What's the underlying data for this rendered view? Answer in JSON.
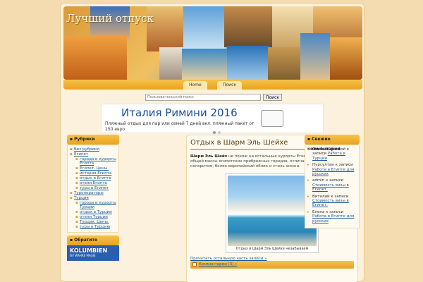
{
  "site": {
    "title": "Лучший отпуск"
  },
  "nav": {
    "tabs": [
      {
        "label": "Home"
      },
      {
        "label": "Поиск"
      }
    ]
  },
  "search": {
    "placeholder": "Пользовательский поиск",
    "button": "Поиск"
  },
  "ad": {
    "headline": "Италия Римини 2016",
    "subtext": "Пляжный отдых для пар или семей 7 дней вкл. пляжный пакет от 150 евро"
  },
  "left_sidebar": {
    "rubrics_title": "Рубрики",
    "categories": [
      {
        "label": "Без рубрики",
        "level": 0
      },
      {
        "label": "Египет",
        "level": 0
      },
      {
        "label": "города и курорты Египта",
        "level": 1
      },
      {
        "label": "Египет. Цены.",
        "level": 1
      },
      {
        "label": "история Египта",
        "level": 1
      },
      {
        "label": "отдых в Египте",
        "level": 1
      },
      {
        "label": "отели Египта",
        "level": 1
      },
      {
        "label": "туры в Египет",
        "level": 1
      },
      {
        "label": "Туроператоры",
        "level": 0
      },
      {
        "label": "Турция",
        "level": 0
      },
      {
        "label": "города и курорты Турции",
        "level": 1
      },
      {
        "label": "отдых в Турции",
        "level": 1
      },
      {
        "label": "отели Турции",
        "level": 1
      },
      {
        "label": "Турция. Цены.",
        "level": 1
      },
      {
        "label": "туры в Турцию",
        "level": 1
      }
    ],
    "attention_title": "Обратите внимание!",
    "banner": {
      "name": "KOLUMBIEN",
      "tagline": "IST WAHRE MAGIE"
    }
  },
  "right_sidebar": {
    "title": "Свежие комментарии",
    "comments": [
      {
        "author": "Отабаев Анобой",
        "text": "к записи",
        "link": "Работа в Турции"
      },
      {
        "author": "Нурсултан",
        "text": "к записи",
        "link": "Работа в Египте для русских"
      },
      {
        "author": "admin",
        "text": "к записи",
        "link": "Стоимость визы в Египет."
      },
      {
        "author": "Виталий",
        "text": "к записи",
        "link": "Стоимость визы в Египет."
      },
      {
        "author": "Елена",
        "text": "к записи",
        "link": "Работа в Египте для русских"
      }
    ]
  },
  "post": {
    "title": "Отдых в Шарм Эль Шейхе",
    "lead_bold": "Шарм Эль Шейх",
    "excerpt": "не похож на остальные курорты Египта. Выделяет его из общей массы египетских прибрежных городов, отличающихся восточным колоритом, более европейский облик и стиль жизни.",
    "image_caption": "Отдых в Шарм Эль Шейхе незабываем",
    "read_more": "Прочитать остальную часть записи »",
    "comments_link": "Комментарии (3) »"
  }
}
